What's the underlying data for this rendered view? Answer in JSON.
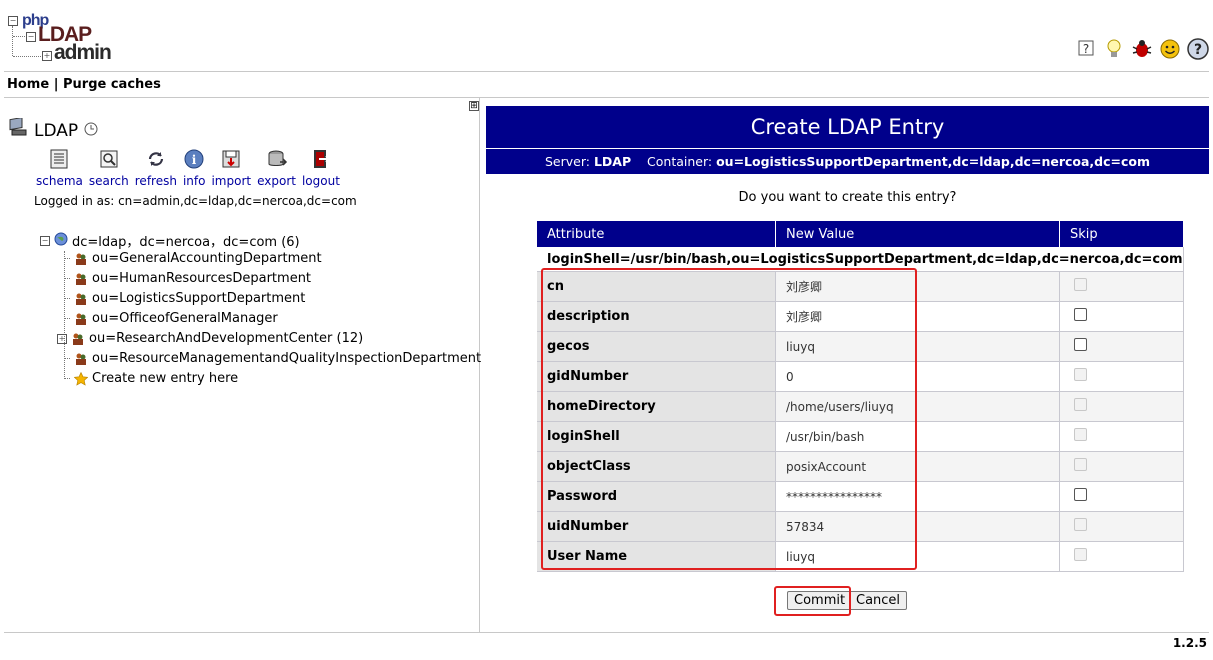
{
  "header": {
    "logo": {
      "php": "php",
      "ldap": "LDAP",
      "admin": "admin"
    },
    "icons": [
      "help-icon",
      "lightbulb-icon",
      "bug-icon",
      "smiley-icon",
      "question-icon"
    ]
  },
  "nav": {
    "home": "Home",
    "separator": "|",
    "purge": "Purge caches"
  },
  "left": {
    "collapse": "⊞",
    "server_name": "LDAP",
    "toolbar": [
      {
        "label": "schema",
        "icon": "schema-icon"
      },
      {
        "label": "search",
        "icon": "search-icon"
      },
      {
        "label": "refresh",
        "icon": "refresh-icon"
      },
      {
        "label": "info",
        "icon": "info-icon"
      },
      {
        "label": "import",
        "icon": "import-icon"
      },
      {
        "label": "export",
        "icon": "export-icon"
      },
      {
        "label": "logout",
        "icon": "logout-icon"
      }
    ],
    "logged_in": "Logged in as: cn=admin,dc=ldap,dc=nercoa,dc=com",
    "tree": {
      "root": "dc=ldap，dc=nercoa，dc=com (6)",
      "items": [
        "ou=GeneralAccountingDepartment",
        "ou=HumanResourcesDepartment",
        "ou=LogisticsSupportDepartment",
        "ou=OfficeofGeneralManager",
        "ou=ResearchAndDevelopmentCenter (12)",
        "ou=ResourceManagementandQualityInspectionDepartment"
      ],
      "create": "Create new entry here"
    }
  },
  "main": {
    "title": "Create LDAP Entry",
    "server_label": "Server:",
    "server_value": "LDAP",
    "container_label": "Container:",
    "container_value": "ou=LogisticsSupportDepartment,dc=ldap,dc=nercoa,dc=com",
    "question": "Do you want to create this entry?",
    "columns": [
      "Attribute",
      "New Value",
      "Skip"
    ],
    "dn": "loginShell=/usr/bin/bash,ou=LogisticsSupportDepartment,dc=ldap,dc=nercoa,dc=com",
    "rows": [
      {
        "attr": "cn",
        "value": "刘彦卿",
        "skip_enabled": false
      },
      {
        "attr": "description",
        "value": "刘彦卿",
        "skip_enabled": true
      },
      {
        "attr": "gecos",
        "value": "liuyq",
        "skip_enabled": true
      },
      {
        "attr": "gidNumber",
        "value": "0",
        "skip_enabled": false
      },
      {
        "attr": "homeDirectory",
        "value": "/home/users/liuyq",
        "skip_enabled": false
      },
      {
        "attr": "loginShell",
        "value": "/usr/bin/bash",
        "skip_enabled": false
      },
      {
        "attr": "objectClass",
        "value": "posixAccount",
        "skip_enabled": false
      },
      {
        "attr": "Password",
        "value": "****************",
        "skip_enabled": true
      },
      {
        "attr": "uidNumber",
        "value": "57834",
        "skip_enabled": false
      },
      {
        "attr": "User Name",
        "value": "liuyq",
        "skip_enabled": false
      }
    ],
    "commit": "Commit",
    "cancel": "Cancel"
  },
  "footer": {
    "version": "1.2.5"
  }
}
